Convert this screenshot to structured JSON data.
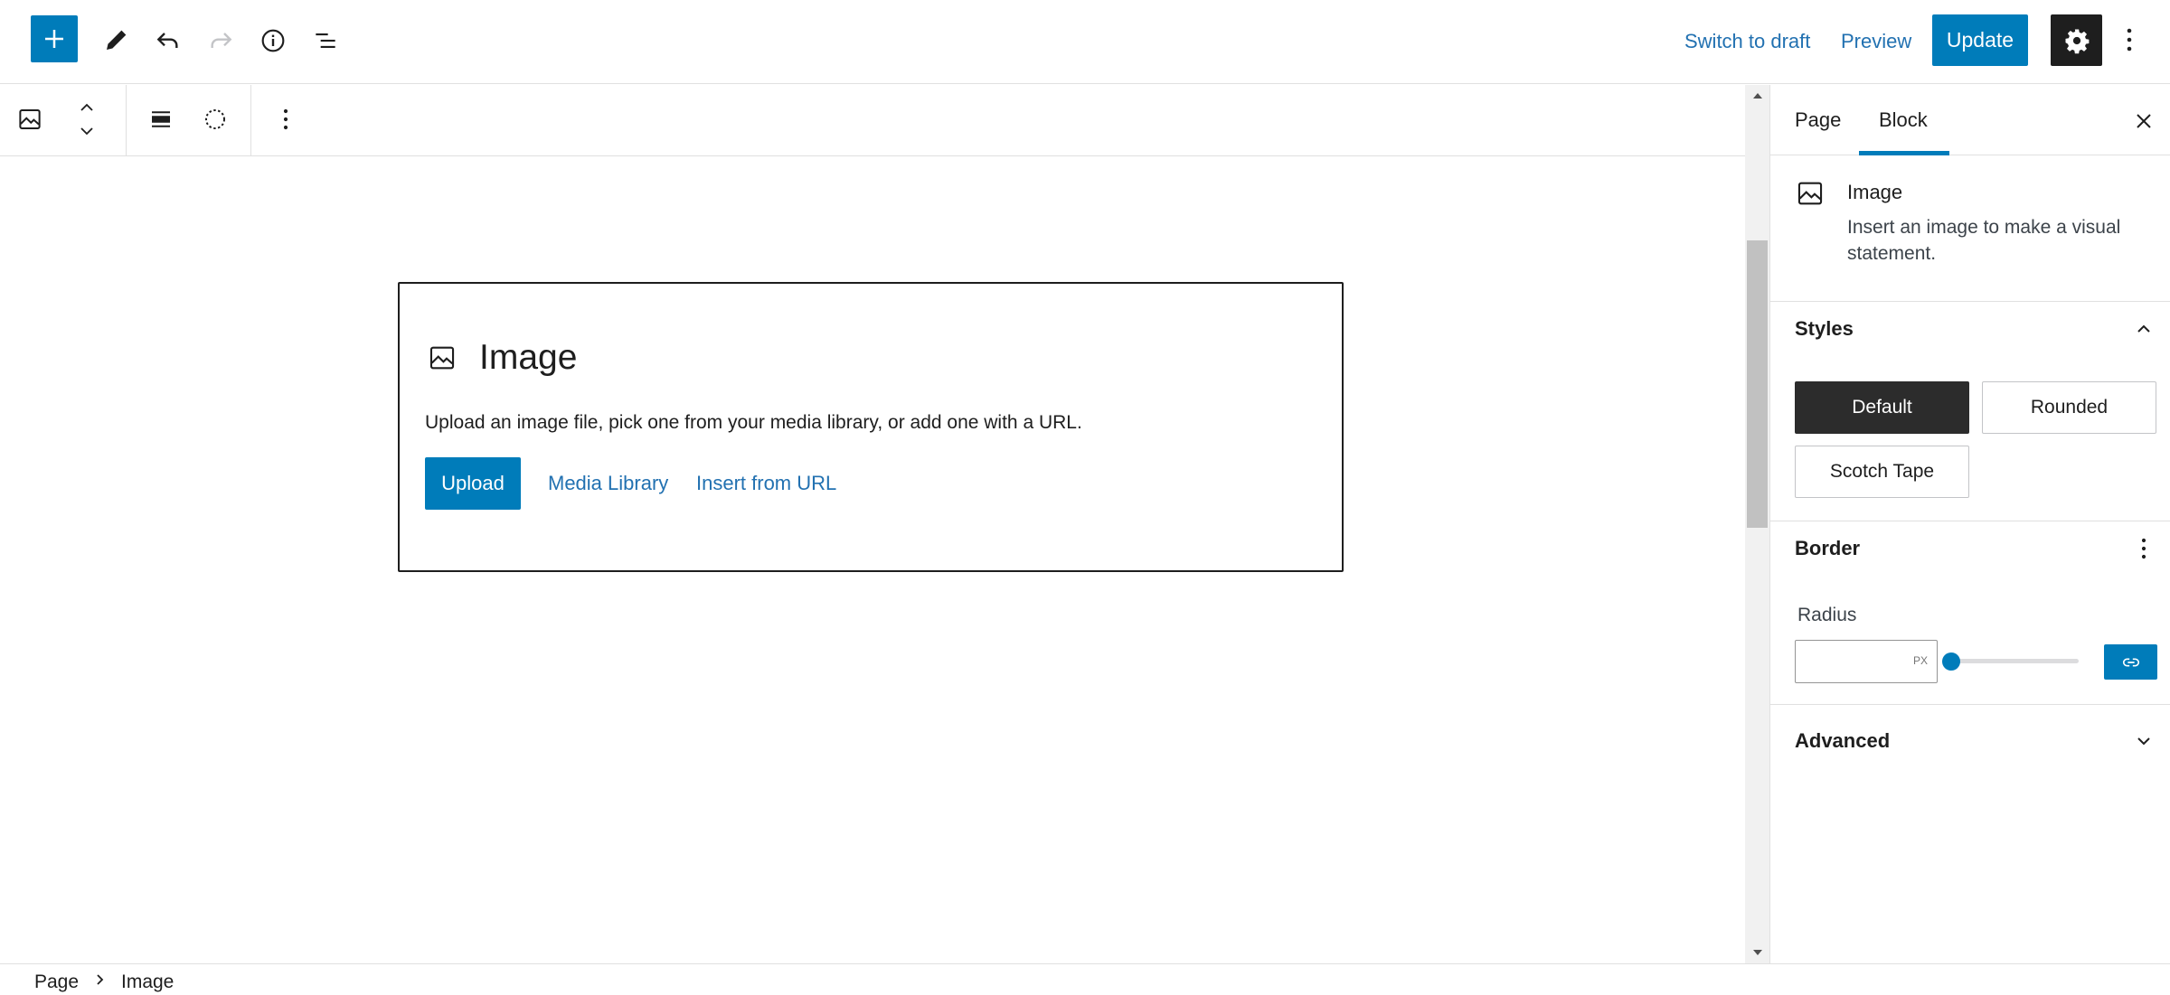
{
  "header": {
    "switch_to_draft": "Switch to draft",
    "preview": "Preview",
    "update": "Update",
    "icons": {
      "inserter": "plus-icon",
      "tools": "pencil-icon",
      "undo": "undo-icon",
      "redo": "redo-icon",
      "details": "info-icon",
      "list_view": "list-view-icon",
      "settings": "gear-icon",
      "options": "more-vertical-icon"
    }
  },
  "block_toolbar": {
    "icons": [
      "image-icon",
      "move-up-down-icon",
      "align-icon",
      "duotone-icon",
      "more-vertical-icon"
    ]
  },
  "image_block": {
    "title": "Image",
    "instructions": "Upload an image file, pick one from your media library, or add one with a URL.",
    "upload": "Upload",
    "media_library": "Media Library",
    "insert_from_url": "Insert from URL"
  },
  "sidebar": {
    "tabs": [
      "Page",
      "Block"
    ],
    "active_tab": "Block",
    "block_card": {
      "title": "Image",
      "description": "Insert an image to make a visual statement."
    },
    "styles": {
      "title": "Styles",
      "options": [
        "Default",
        "Rounded",
        "Scotch Tape"
      ],
      "selected": "Default"
    },
    "border": {
      "title": "Border",
      "radius_label": "Radius",
      "radius_value": "",
      "radius_unit": "PX",
      "radius_slider": 0
    },
    "advanced": {
      "title": "Advanced"
    }
  },
  "footer": {
    "breadcrumb": [
      "Page",
      "Image"
    ]
  },
  "colors": {
    "accent": "#007cba",
    "link": "#2271b1",
    "dark": "#1e1e1e"
  }
}
